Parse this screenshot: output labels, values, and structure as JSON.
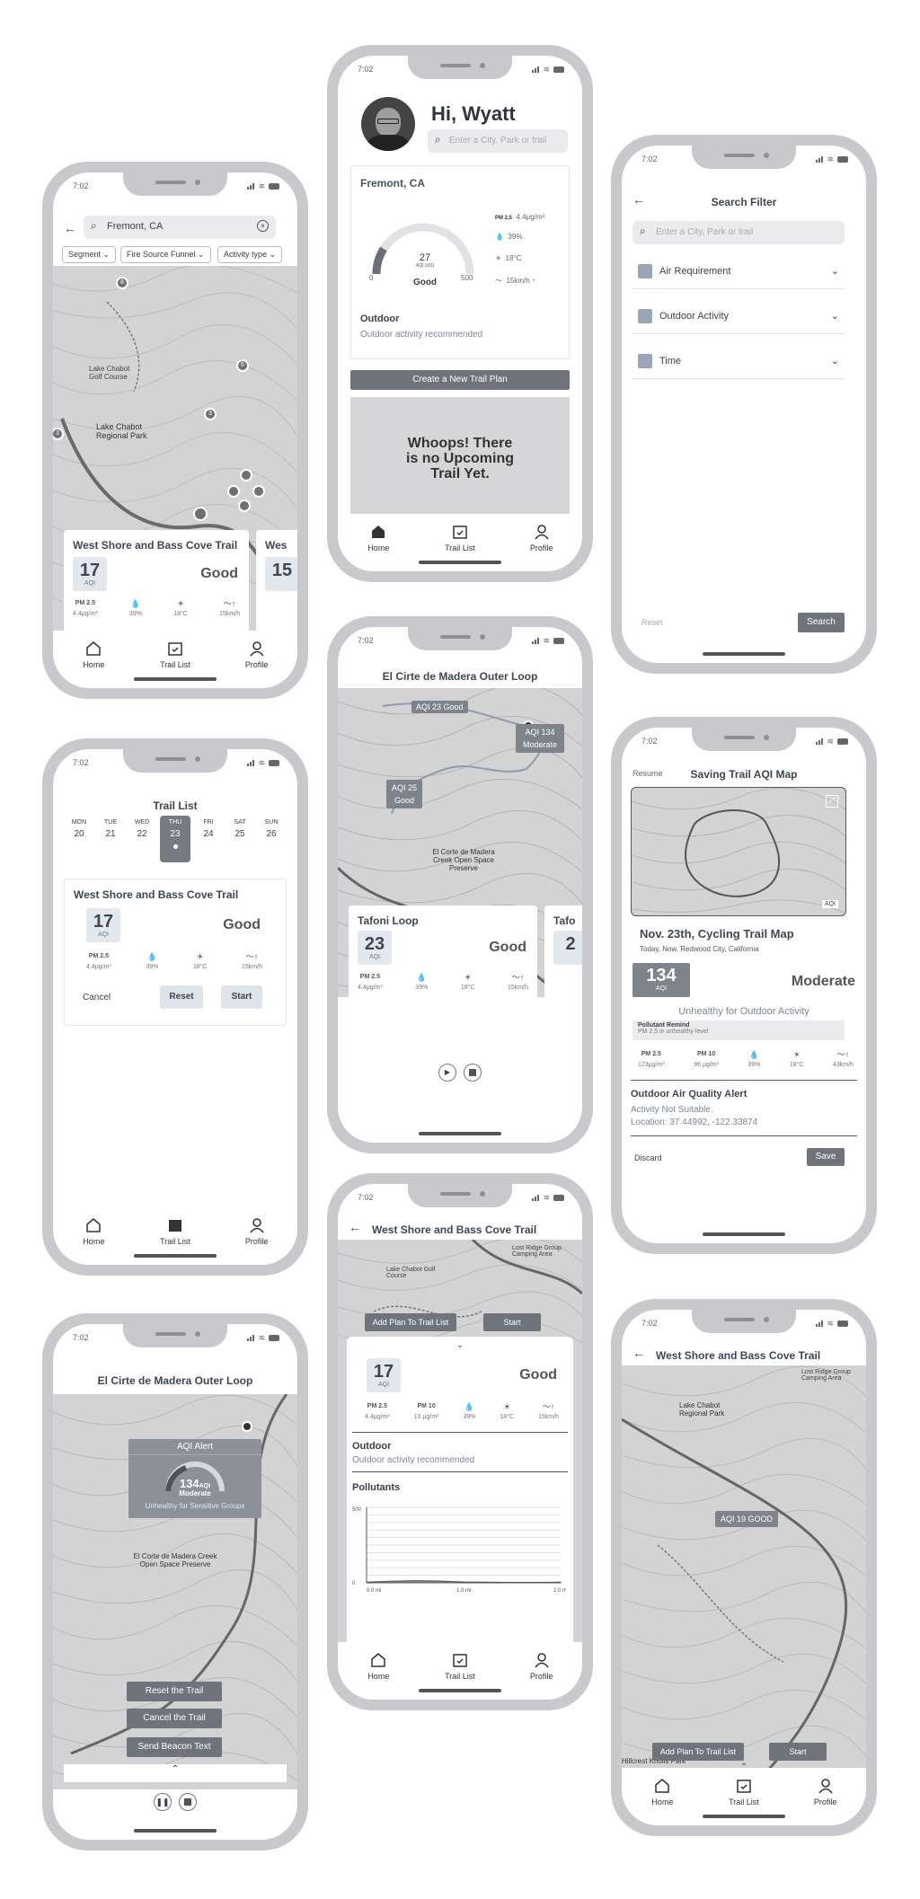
{
  "status_time": "7:02",
  "nav": {
    "home": "Home",
    "trail_list": "Trail List",
    "profile": "Profile"
  },
  "metrics": {
    "pm25": "PM\n2.5",
    "pm10": "PM\n10",
    "pm25_val": "4.4μg/m³",
    "pm10_val": "10 μg/m³",
    "humidity": "39%",
    "temp": "18°C",
    "wind": "15km/h"
  },
  "screen_map": {
    "search_value": "Fremont, CA",
    "filters": [
      "Segment",
      "Fire Source Funnel",
      "Activity type"
    ],
    "map_labels": [
      "Lake Chabot Golf Course",
      "Lake Chabot Regional Park"
    ],
    "pins": [
      "8",
      "6",
      "3",
      "3"
    ],
    "card1": {
      "title": "West Shore and Bass Cove Trail",
      "aqi": "17",
      "aqi_label": "AQI",
      "status": "Good"
    },
    "card2": {
      "title": "Wes",
      "aqi": "15"
    }
  },
  "screen_home": {
    "greeting": "Hi, Wyatt",
    "search_placeholder": "Enter a City, Park or trail",
    "location": "Fremont, CA",
    "gauge_value": "27",
    "gauge_unit": "AQI (US)",
    "gauge_min": "0",
    "gauge_max": "500",
    "gauge_status": "Good",
    "pm": "4.4μg/m³",
    "humidity": "39%",
    "temp": "18°C",
    "wind": "15km/h",
    "section": "Outdoor",
    "recommendation": "Outdoor activity recommended",
    "create_button": "Create a New Trail Plan",
    "empty_message": "Whoops! There is no Upcoming Trail Yet."
  },
  "screen_filter": {
    "title": "Search Filter",
    "search_placeholder": "Enter a City, Park or trail",
    "options": [
      "Air Requirement",
      "Outdoor Activity",
      "Time"
    ],
    "reset": "Reset",
    "search": "Search"
  },
  "screen_tracking": {
    "title": "El Cirte de Madera Outer Loop",
    "bubble1": "AQI 23 Good",
    "bubble2": "AQI 134 Moderate",
    "bubble3": "AQI 25 Good",
    "map_labels": [
      "El Corte de Madera Creek Open Space Preserve"
    ],
    "card": {
      "title": "Tafoni Loop",
      "aqi": "23",
      "aqi_label": "AQI",
      "status": "Good"
    },
    "card2": {
      "title": "Tafo",
      "aqi": "2"
    }
  },
  "screen_trail_list": {
    "title": "Trail List",
    "days": [
      {
        "dow": "MON",
        "date": "20"
      },
      {
        "dow": "TUE",
        "date": "21"
      },
      {
        "dow": "WED",
        "date": "22"
      },
      {
        "dow": "THU",
        "date": "23"
      },
      {
        "dow": "FRI",
        "date": "24"
      },
      {
        "dow": "SAT",
        "date": "25"
      },
      {
        "dow": "SUN",
        "date": "26"
      }
    ],
    "card": {
      "title": "West Shore and Bass Cove Trail",
      "aqi": "17",
      "aqi_label": "AQI",
      "status": "Good"
    },
    "cancel": "Cancel",
    "reset": "Reset",
    "start": "Start"
  },
  "screen_saving": {
    "resume": "Resume",
    "title": "Saving Trail AQI Map",
    "map_badge": "AQI",
    "plan_title": "Nov. 23th, Cycling Trail Map",
    "subtitle": "Today, Now, Redwood City, California",
    "aqi": "134",
    "aqi_label": "AQI",
    "status": "Moderate",
    "advice": "Unhealthy for Outdoor Activity",
    "remind_title": "Pollutant Remind",
    "remind_text": "PM 2.5 in unhealthy level",
    "m_pm25": "123μg/m³",
    "m_pm10": "96 μg/m³",
    "m_hum": "39%",
    "m_temp": "18°C",
    "m_wind": "43km/h",
    "alert_title": "Outdoor Air Quality Alert",
    "alert_line1": "Activity Not Suitable.",
    "alert_line2": "Location: 37.44992, -122.33874",
    "discard": "Discard",
    "save": "Save"
  },
  "screen_alert": {
    "title": "El Cirte de Madera Outer Loop",
    "alert_header": "AQI Alert",
    "aqi": "134",
    "aqi_unit": "AQI",
    "status": "Moderate",
    "advice": "Unhealthy for Sensitive Groups",
    "map_labels": [
      "El Corte de Madera Creek Open Space Preserve"
    ],
    "buttons": [
      "Reset the Trail",
      "Cancel the Trail",
      "Send Beacon Text"
    ]
  },
  "screen_detail": {
    "title": "West Shore and Bass Cove Trail",
    "map_labels": [
      "Lake Chabot Golf Course",
      "Lost Ridge Group Camping Area"
    ],
    "add_plan": "Add Plan To Trail List",
    "start": "Start",
    "aqi": "17",
    "aqi_label": "AQI",
    "status": "Good",
    "section": "Outdoor",
    "recommendation": "Outdoor activity recommended",
    "pollutants": "Pollutants",
    "chart_data": {
      "type": "area",
      "x_ticks": [
        "0.0 mi",
        "1.0 mi",
        "2.0 mi"
      ],
      "y_ticks": [
        "500",
        "0"
      ],
      "ylim": [
        0,
        500
      ],
      "series": [
        {
          "values": [
            5,
            10,
            14,
            12,
            6,
            4,
            3,
            3,
            4
          ]
        }
      ]
    }
  },
  "screen_route": {
    "title": "West Shore and Bass Cove Trail",
    "map_labels": [
      "Lake Chabot Regional Park",
      "Lost Ridge Group Camping Area",
      "Hillcrest Knolls Park"
    ],
    "bubble": "AQI 19 GOOD",
    "add_plan": "Add Plan To Trail List",
    "start": "Start"
  }
}
